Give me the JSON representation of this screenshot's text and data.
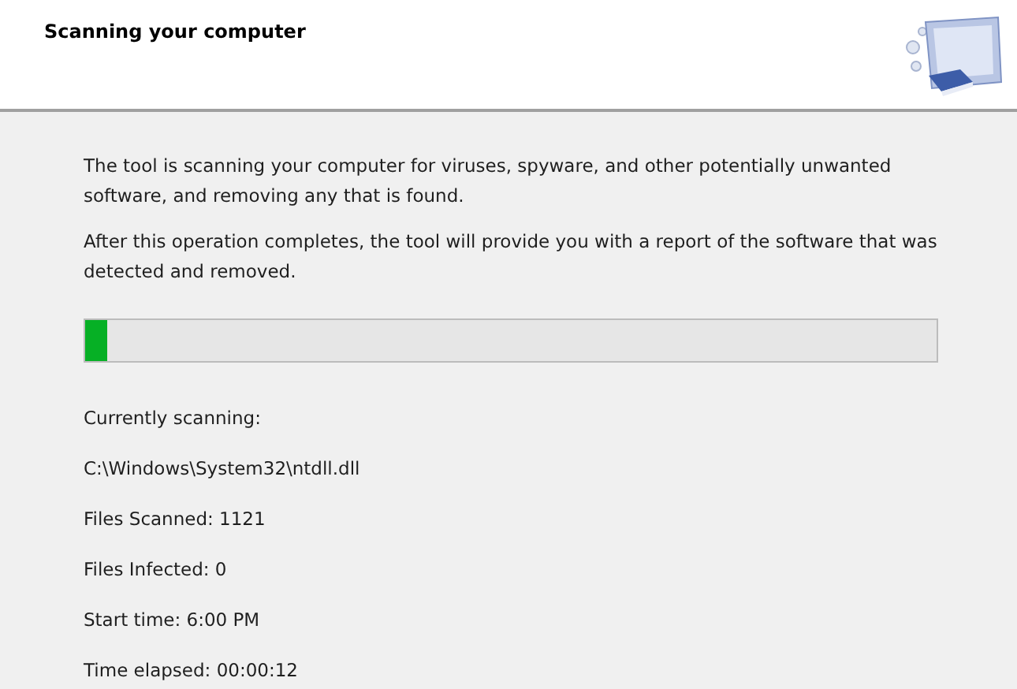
{
  "header": {
    "title": "Scanning your computer"
  },
  "paragraphs": [
    "The tool is scanning your computer for viruses, spyware, and other potentially unwanted software, and removing any that is found.",
    "After this operation completes, the tool will provide you with a report of the software that was detected and removed."
  ],
  "progress": {
    "level": 0.025
  },
  "status_lines": [
    "Currently scanning:",
    "C:\\Windows\\System32\\ntdll.dll",
    "Files Scanned: 1121",
    "Files Infected: 0",
    "Start time: 6:00 PM",
    "Time elapsed: 00:00:12"
  ]
}
